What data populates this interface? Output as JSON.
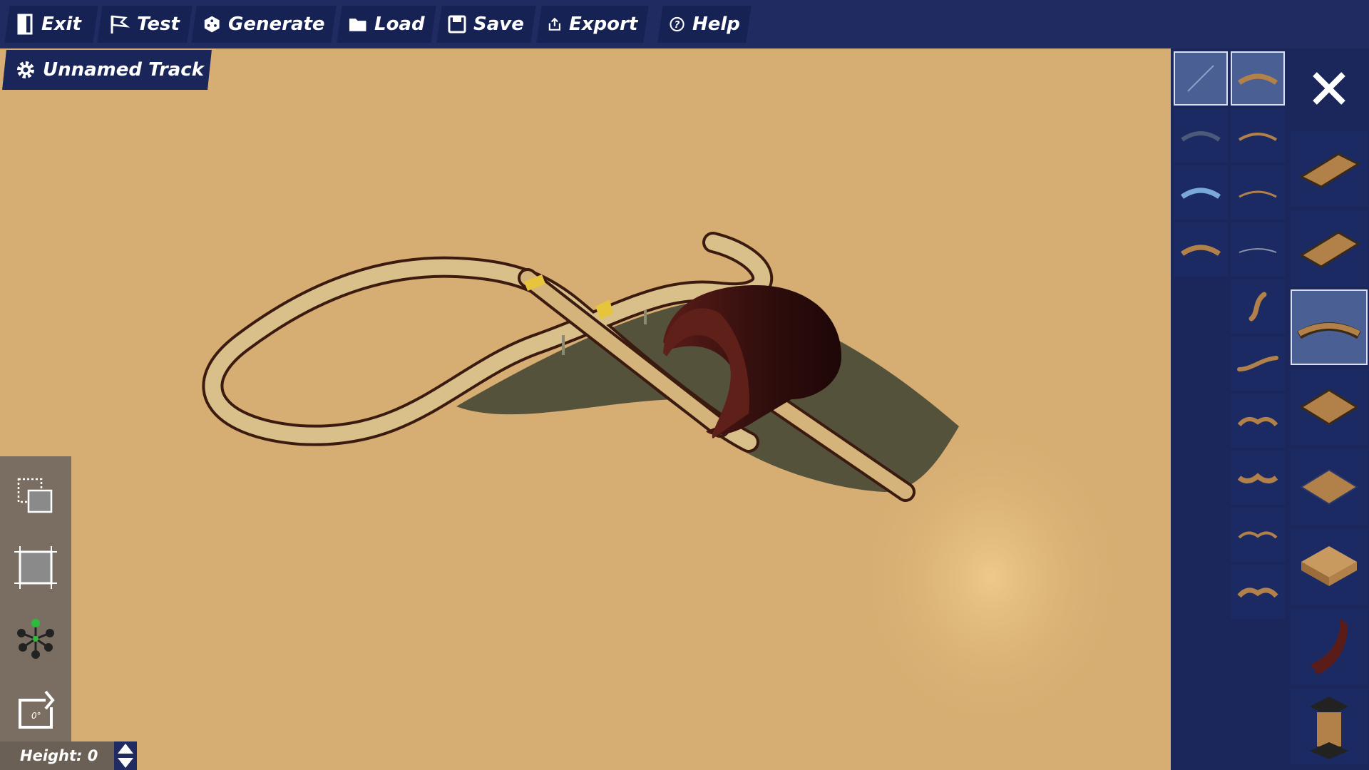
{
  "toolbar": {
    "exit_label": "Exit",
    "test_label": "Test",
    "generate_label": "Generate",
    "load_label": "Load",
    "save_label": "Save",
    "export_label": "Export",
    "help_label": "Help"
  },
  "track": {
    "name": "Unnamed Track"
  },
  "height": {
    "label": "Height: 0",
    "value": 0
  },
  "colors": {
    "toolbar_bg": "#1f2b61",
    "ground": "#d6ad72",
    "track_surface": "#d9c08a",
    "track_edge": "#4a1c10",
    "tunnel": "#3b1110",
    "palette_bg": "#1b275a",
    "selected_cell": "#4a5f93"
  },
  "tools": [
    {
      "name": "select-tool",
      "icon": "dotted-select-icon"
    },
    {
      "name": "resize-tool",
      "icon": "crop-frame-icon"
    },
    {
      "name": "node-tool",
      "icon": "node-graph-icon"
    },
    {
      "name": "rotate-tool",
      "icon": "rotate-0-icon",
      "text": "0°"
    }
  ],
  "palette": {
    "selected_piece": "curve-piece",
    "small_pieces": [
      "straight-diagonal",
      "arc-wide",
      "arc-dark",
      "arc-thin",
      "arc-blue",
      "arc-thin-2",
      "arc-flat",
      "arc-thin-3",
      "s-curve",
      "wave",
      "bump-double",
      "bump-wide",
      "bump-thin",
      "bump-mid"
    ],
    "big_pieces": [
      "flat-plate",
      "ramp-plate",
      "curve-piece",
      "diamond-plate",
      "diamond-flat",
      "block-plate",
      "quarter-pipe",
      "pillar"
    ]
  }
}
